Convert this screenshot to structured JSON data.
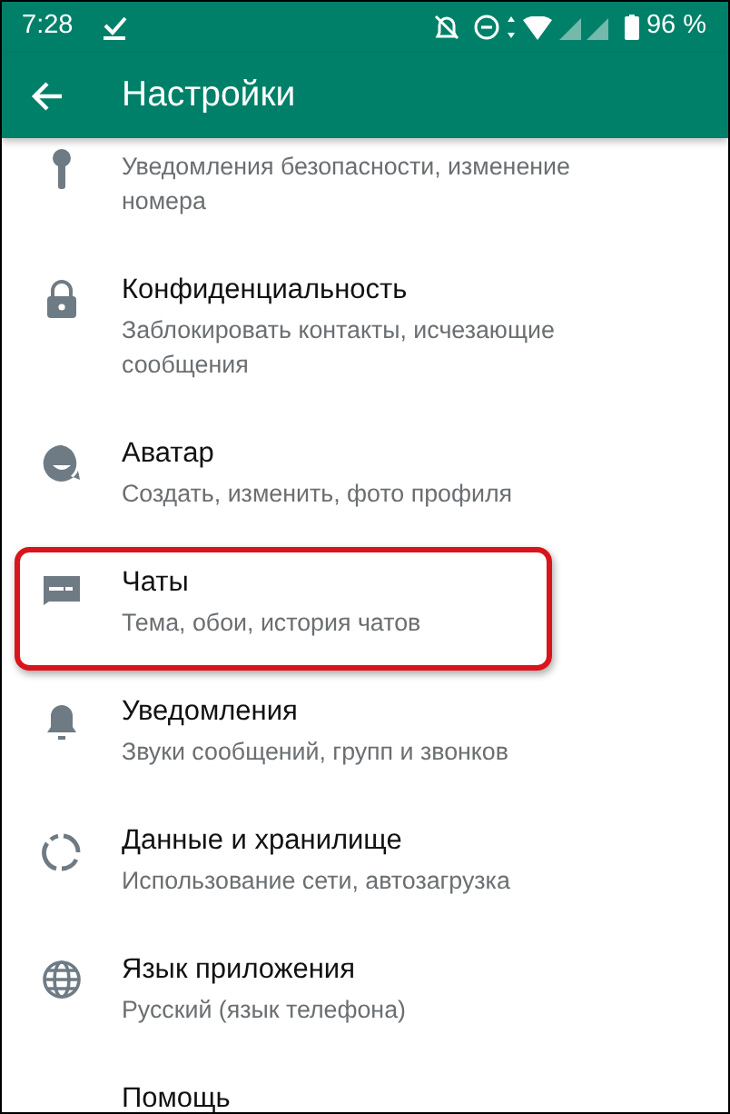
{
  "status_bar": {
    "time": "7:28",
    "battery": "96 %"
  },
  "toolbar": {
    "title": "Настройки"
  },
  "items": [
    {
      "kind": "key",
      "subtitle": "Уведомления безопасности, изменение номера",
      "highlighted": false
    },
    {
      "kind": "lock",
      "title": "Конфиденциальность",
      "subtitle": "Заблокировать контакты, исчезающие сообщения",
      "highlighted": false
    },
    {
      "kind": "avatar",
      "title": "Аватар",
      "subtitle": "Создать, изменить, фото профиля",
      "highlighted": false
    },
    {
      "kind": "chat",
      "title": "Чаты",
      "subtitle": "Тема, обои, история чатов",
      "highlighted": true
    },
    {
      "kind": "bell",
      "title": "Уведомления",
      "subtitle": "Звуки сообщений, групп и звонков",
      "highlighted": false
    },
    {
      "kind": "data",
      "title": "Данные и хранилище",
      "subtitle": "Использование сети, автозагрузка",
      "highlighted": false
    },
    {
      "kind": "globe",
      "title": "Язык приложения",
      "subtitle": "Русский (язык телефона)",
      "highlighted": false
    },
    {
      "title": "Помощь",
      "highlighted": false
    }
  ]
}
